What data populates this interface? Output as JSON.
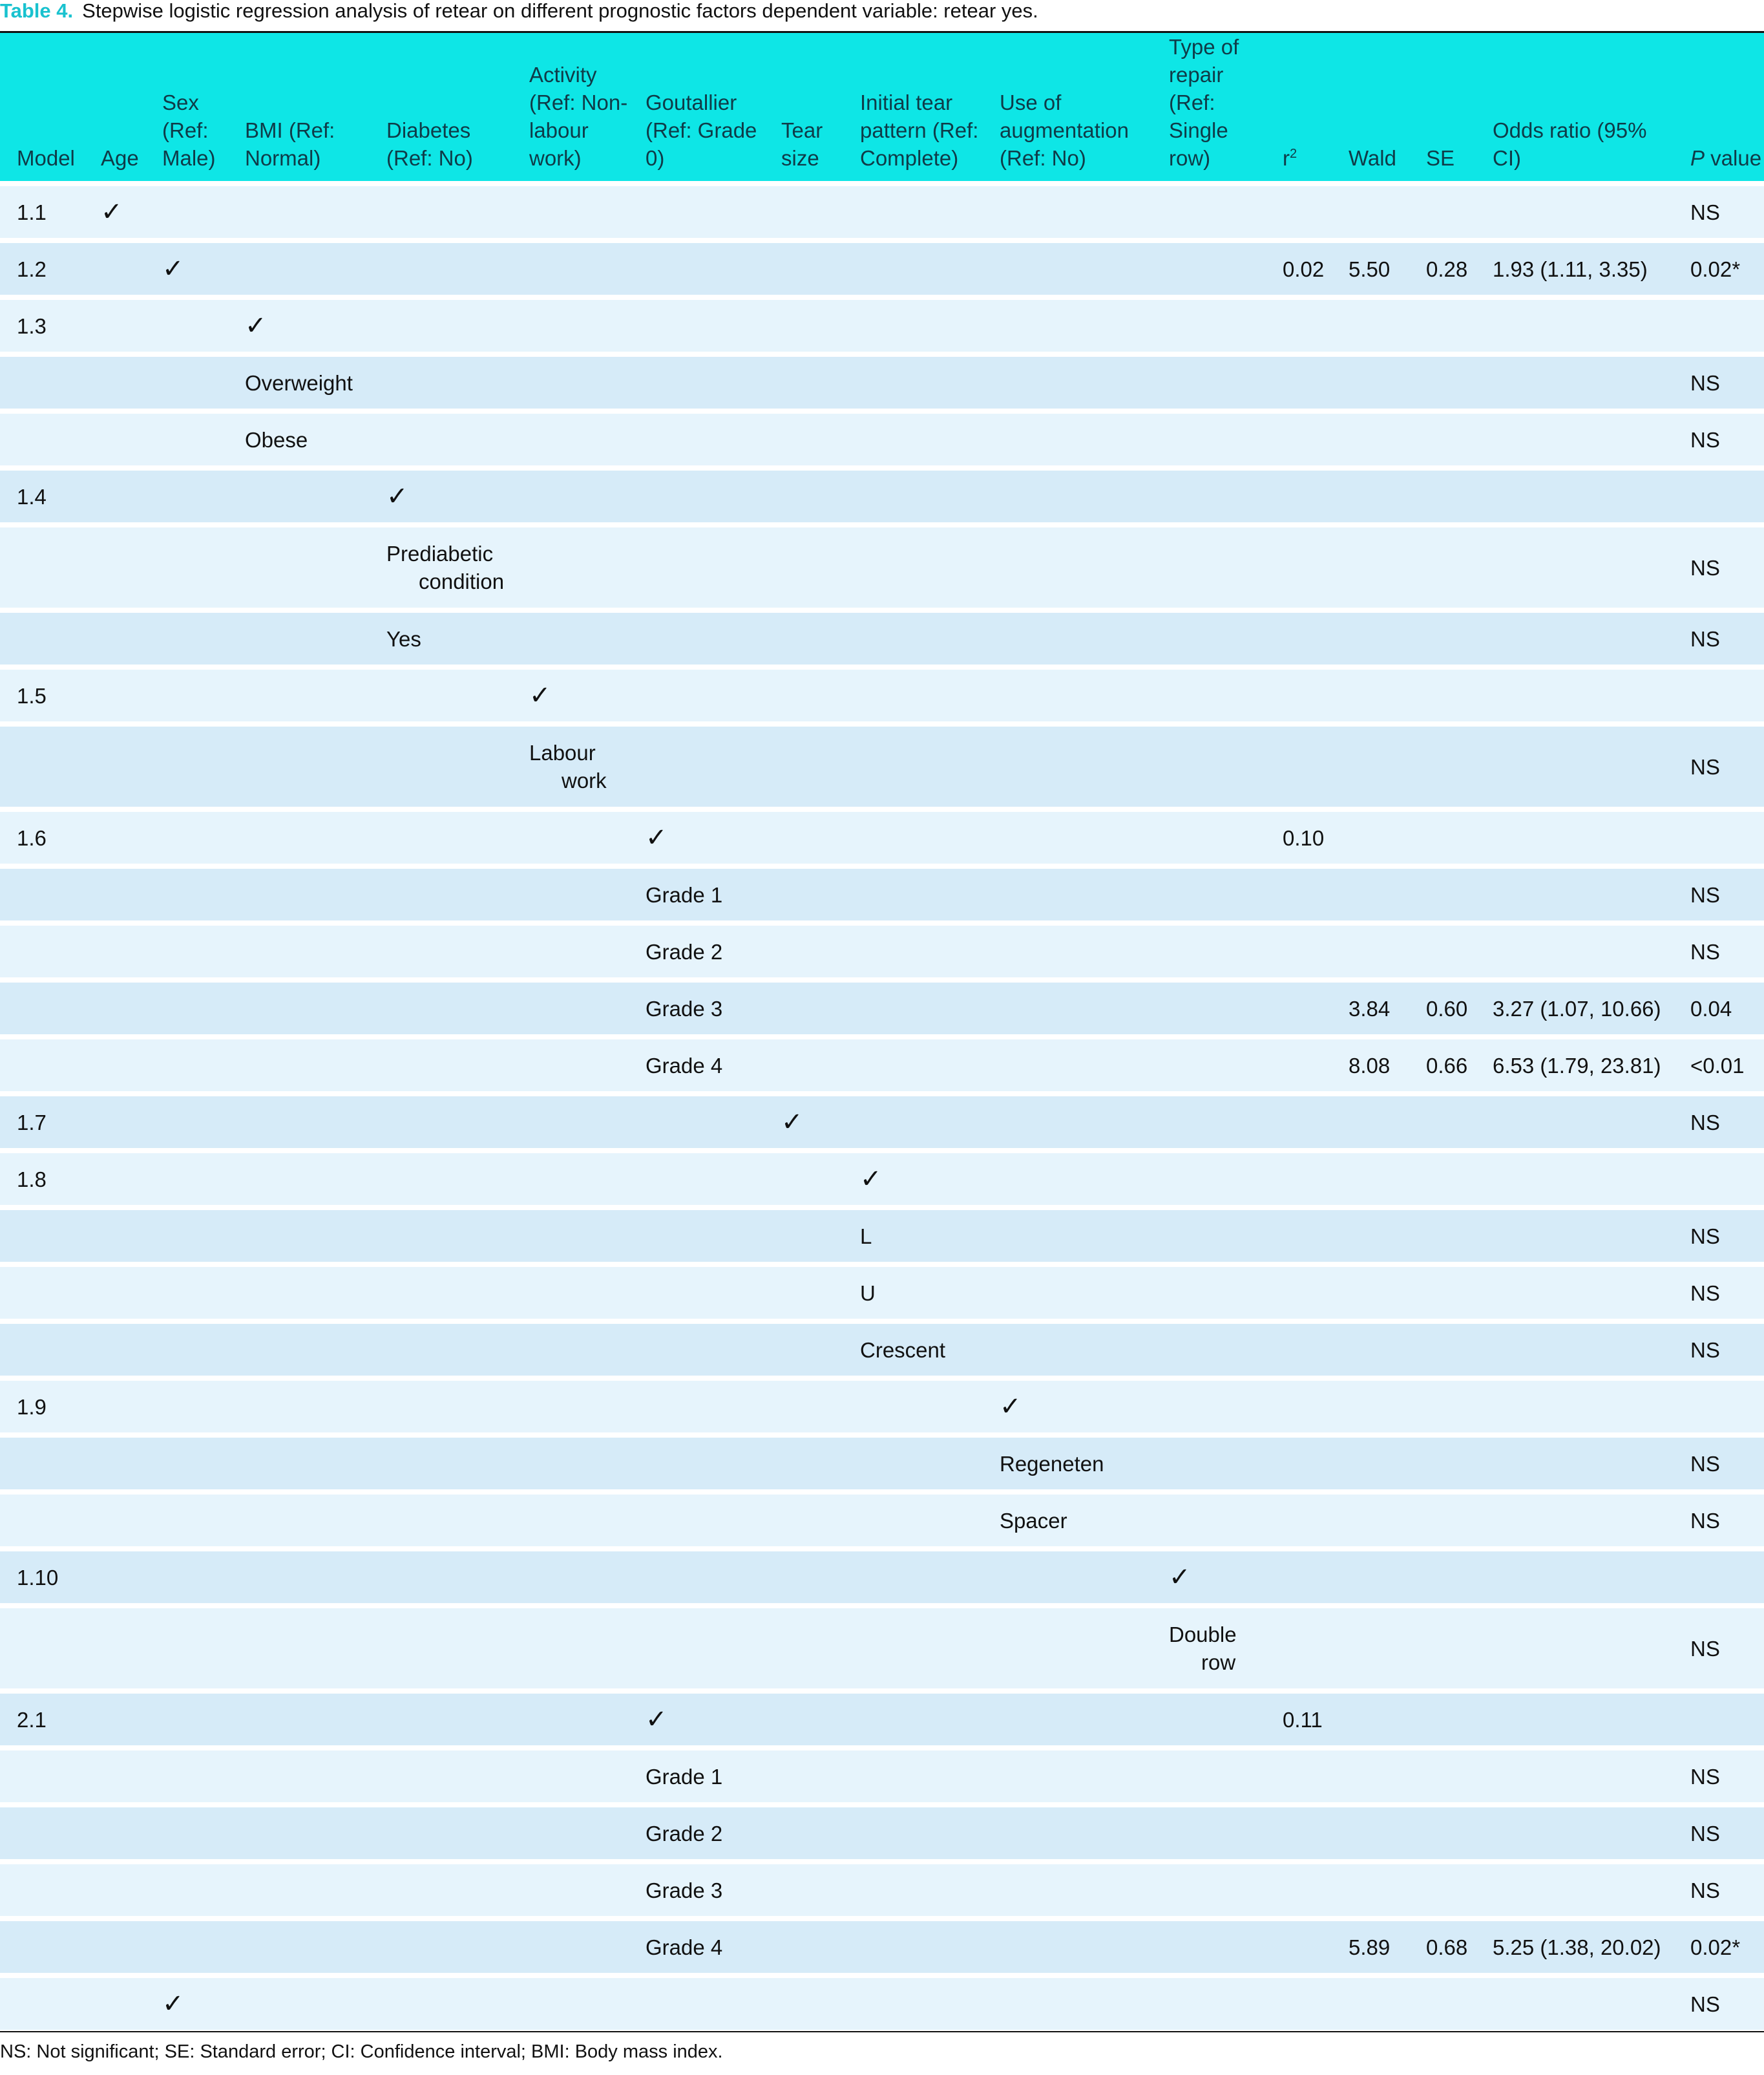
{
  "caption": {
    "label": "Table 4.",
    "text": "Stepwise logistic regression analysis of retear on different prognostic factors dependent variable: retear yes."
  },
  "columns": [
    "Model",
    "Age",
    "Sex (Ref: Male)",
    "BMI (Ref: Normal)",
    "Diabetes (Ref: No)",
    "Activity (Ref: Non-labour work)",
    "Goutallier (Ref: Grade 0)",
    "Tear size",
    "Initial tear pattern (Ref: Complete)",
    "Use of augmentation (Ref: No)",
    "Type of repair (Ref: Single row)",
    "r2",
    "Wald",
    "SE",
    "Odds ratio (95% CI)",
    "P value"
  ],
  "rows": [
    {
      "model": "1.1",
      "col": "age",
      "mark": "✓",
      "p": "NS"
    },
    {
      "model": "1.2",
      "col": "sex",
      "mark": "✓",
      "r2": "0.02",
      "wald": "5.50",
      "se": "0.28",
      "or": "1.93 (1.11, 3.35)",
      "p": "0.02*"
    },
    {
      "model": "1.3",
      "col": "bmi",
      "mark": "✓"
    },
    {
      "col": "bmi",
      "mark": "Overweight",
      "p": "NS"
    },
    {
      "col": "bmi",
      "mark": "Obese",
      "p": "NS"
    },
    {
      "model": "1.4",
      "col": "diabetes",
      "mark": "✓"
    },
    {
      "col": "diabetes",
      "mark": "Prediabetic condition",
      "p": "NS",
      "tall": true
    },
    {
      "col": "diabetes",
      "mark": "Yes",
      "p": "NS"
    },
    {
      "model": "1.5",
      "col": "activity",
      "mark": "✓"
    },
    {
      "col": "activity",
      "mark": "Labour work",
      "p": "NS",
      "tall": true
    },
    {
      "model": "1.6",
      "col": "goutallier",
      "mark": "✓",
      "r2": "0.10"
    },
    {
      "col": "goutallier",
      "mark": "Grade 1",
      "p": "NS"
    },
    {
      "col": "goutallier",
      "mark": "Grade 2",
      "p": "NS"
    },
    {
      "col": "goutallier",
      "mark": "Grade 3",
      "wald": "3.84",
      "se": "0.60",
      "or": "3.27 (1.07, 10.66)",
      "p": "0.04"
    },
    {
      "col": "goutallier",
      "mark": "Grade 4",
      "wald": "8.08",
      "se": "0.66",
      "or": "6.53 (1.79, 23.81)",
      "p": "<0.01"
    },
    {
      "model": "1.7",
      "col": "tear",
      "mark": "✓",
      "p": "NS"
    },
    {
      "model": "1.8",
      "col": "pattern",
      "mark": "✓"
    },
    {
      "col": "pattern",
      "mark": "L",
      "p": "NS"
    },
    {
      "col": "pattern",
      "mark": "U",
      "p": "NS"
    },
    {
      "col": "pattern",
      "mark": "Crescent",
      "p": "NS"
    },
    {
      "model": "1.9",
      "col": "augment",
      "mark": "✓"
    },
    {
      "col": "augment",
      "mark": "Regeneten",
      "p": "NS"
    },
    {
      "col": "augment",
      "mark": "Spacer",
      "p": "NS"
    },
    {
      "model": "1.10",
      "col": "repair",
      "mark": "✓"
    },
    {
      "col": "repair",
      "mark": "Double row",
      "p": "NS",
      "tall": true
    },
    {
      "model": "2.1",
      "col": "goutallier",
      "mark": "✓",
      "r2": "0.11"
    },
    {
      "col": "goutallier",
      "mark": "Grade 1",
      "p": "NS"
    },
    {
      "col": "goutallier",
      "mark": "Grade 2",
      "p": "NS"
    },
    {
      "col": "goutallier",
      "mark": "Grade 3",
      "p": "NS"
    },
    {
      "col": "goutallier",
      "mark": "Grade 4",
      "wald": "5.89",
      "se": "0.68",
      "or": "5.25 (1.38, 20.02)",
      "p": "0.02*"
    },
    {
      "col": "sex",
      "mark": "✓",
      "p": "NS"
    }
  ],
  "footnote": "NS: Not significant; SE: Standard error; CI: Confidence interval; BMI: Body mass index."
}
